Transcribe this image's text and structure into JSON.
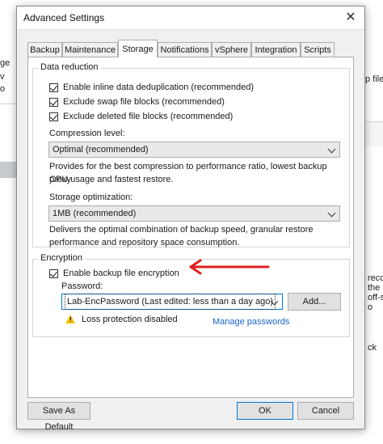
{
  "background": {
    "left_text_1": "ge",
    "left_text_2": "v",
    "left_text_3": "o",
    "right_text_1": "p file",
    "right_text_2": "recc",
    "right_text_3": "the",
    "right_text_4": "off-s",
    "right_text_5": "o",
    "right_text_6": "ck"
  },
  "dialog": {
    "title": "Advanced Settings",
    "close_glyph": "✕"
  },
  "tabs": [
    {
      "label": "Backup"
    },
    {
      "label": "Maintenance"
    },
    {
      "label": "Storage"
    },
    {
      "label": "Notifications"
    },
    {
      "label": "vSphere"
    },
    {
      "label": "Integration"
    },
    {
      "label": "Scripts"
    }
  ],
  "active_tab": "Storage",
  "data_reduction": {
    "group_label": "Data reduction",
    "inline_dedup": {
      "label": "Enable inline data deduplication (recommended)",
      "checked": true
    },
    "exclude_swap": {
      "label": "Exclude swap file blocks (recommended)",
      "checked": true
    },
    "exclude_deleted": {
      "label": "Exclude deleted file blocks (recommended)",
      "checked": true
    },
    "compression_label": "Compression level:",
    "compression_value": "Optimal (recommended)",
    "compression_desc_1": "Provides for the best compression to performance ratio, lowest backup proxy",
    "compression_desc_2": "CPU usage and fastest restore.",
    "storage_opt_label": "Storage optimization:",
    "storage_opt_value": "1MB (recommended)",
    "storage_opt_desc_1": "Delivers the optimal combination of backup speed, granular restore",
    "storage_opt_desc_2": "performance and repository space consumption."
  },
  "encryption": {
    "group_label": "Encryption",
    "enable": {
      "label": "Enable backup file encryption",
      "checked": true
    },
    "password_label": "Password:",
    "password_value": "Lab-EncPassword (Last edited: less than a day ago)",
    "add_button": "Add...",
    "warning_text": "Loss protection disabled",
    "manage_link": "Manage passwords"
  },
  "buttons": {
    "save_default": "Save As Default",
    "ok": "OK",
    "cancel": "Cancel"
  },
  "colors": {
    "annotation_arrow": "#e02020",
    "link": "#1a64c8",
    "warning": "#f5c400",
    "focus_border": "#0078d7"
  }
}
